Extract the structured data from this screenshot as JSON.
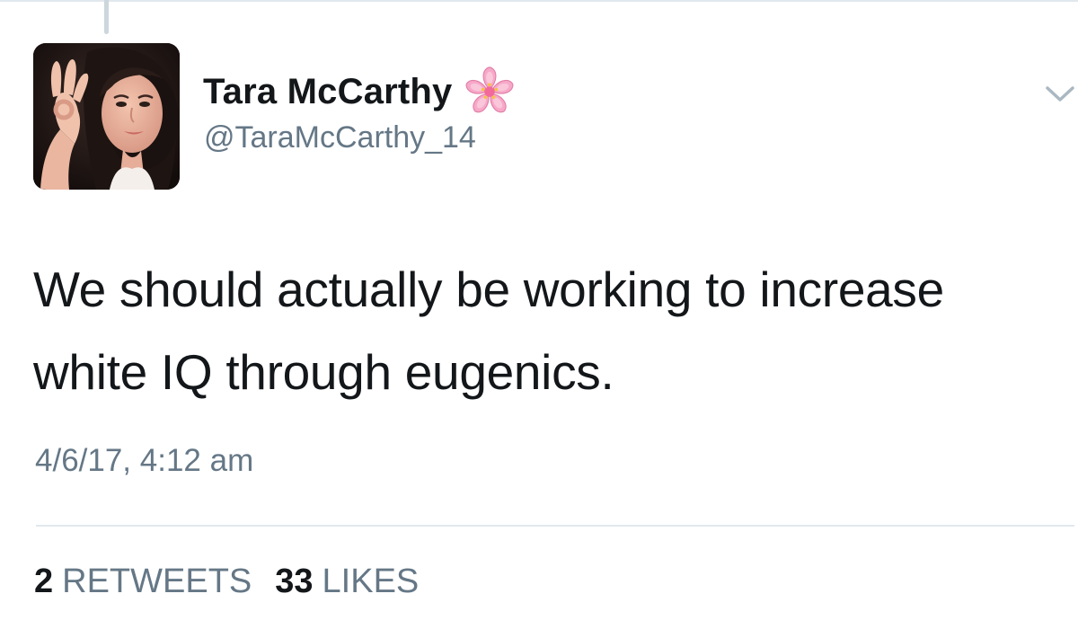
{
  "tweet": {
    "author": {
      "display_name": "Tara McCarthy",
      "name_emoji": "cherry-blossom-icon",
      "handle": "@TaraMcCarthy_14"
    },
    "text_lines": [
      "We should actually be working to increase",
      "white IQ through eugenics."
    ],
    "timestamp": "4/6/17, 4:12 am",
    "stats": {
      "retweets_count": "2",
      "retweets_label": "RETWEETS",
      "likes_count": "33",
      "likes_label": "LIKES"
    }
  },
  "colors": {
    "text_primary": "#14171a",
    "text_secondary": "#657786",
    "divider": "#e1e8ed",
    "thread_line": "#ccd6dd",
    "blossom_pink": "#f7a8c8"
  }
}
